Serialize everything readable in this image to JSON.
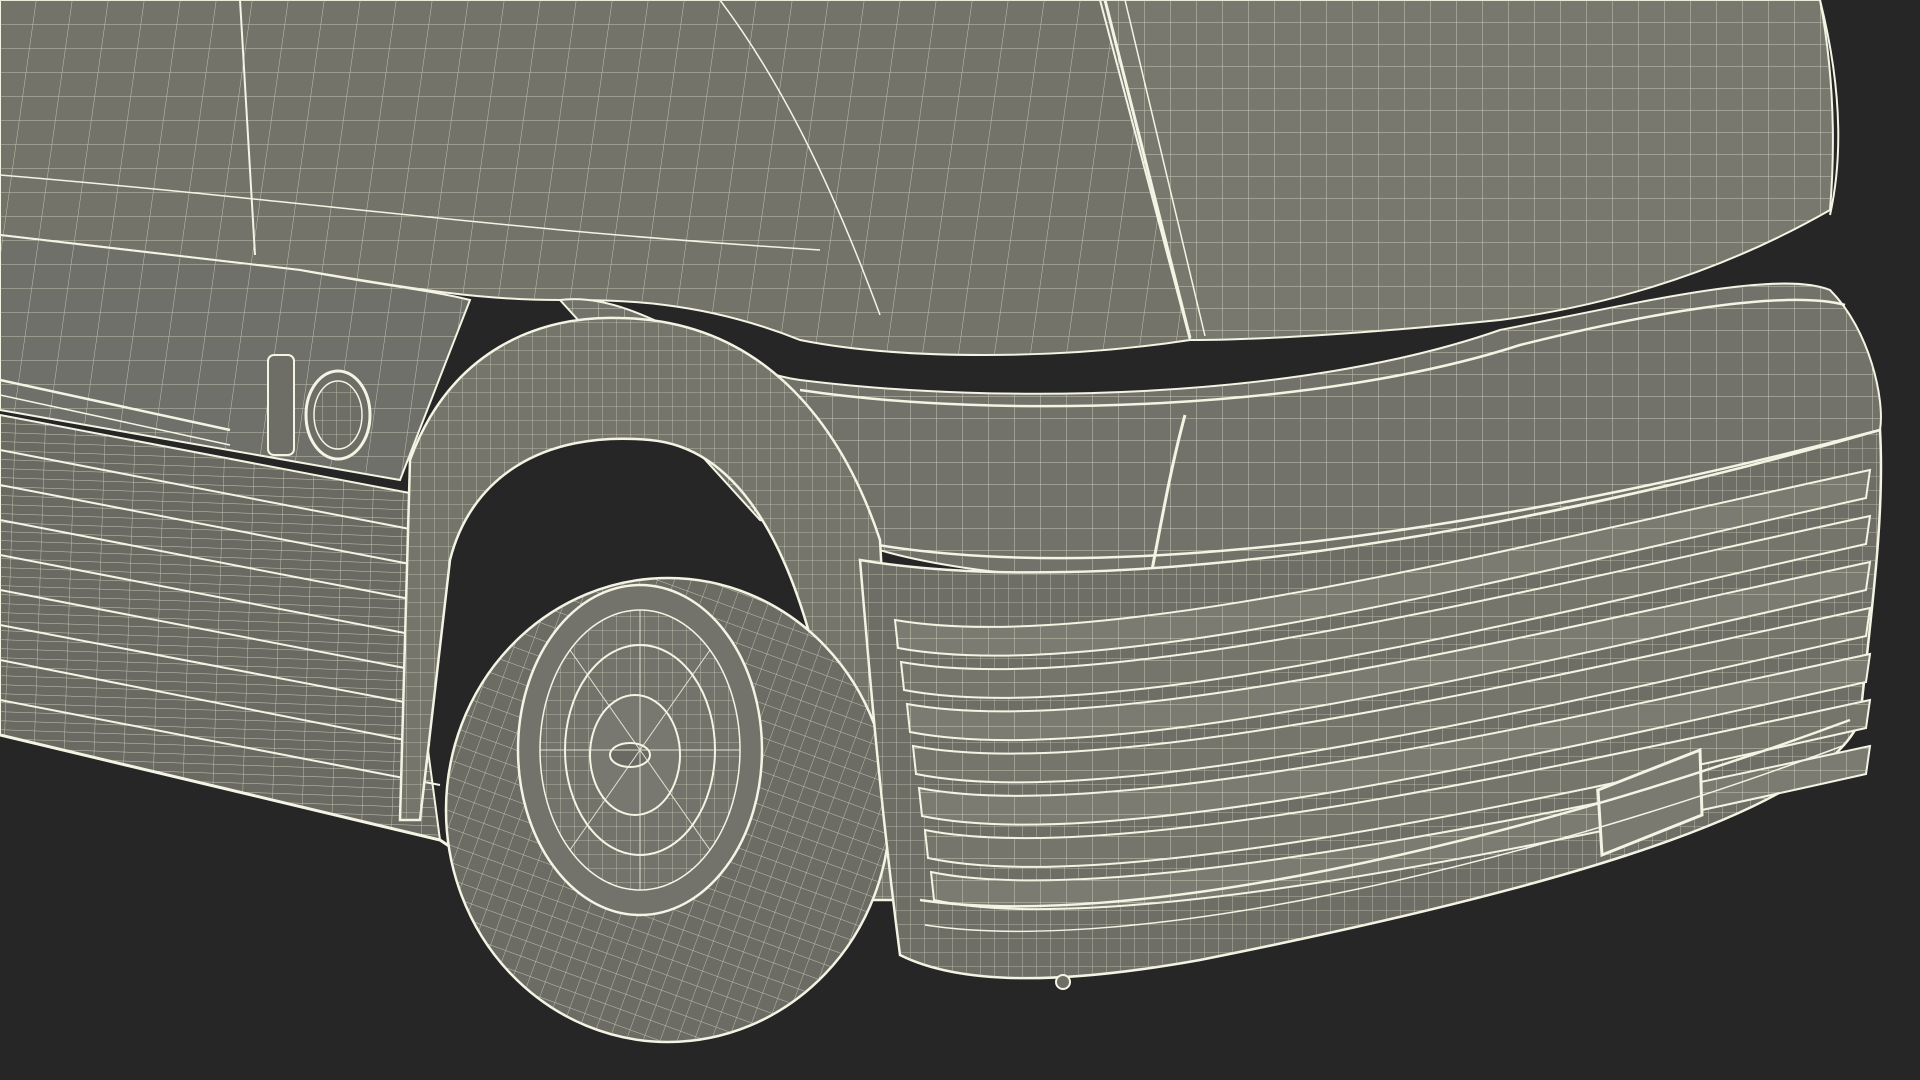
{
  "scene": {
    "subject": "wireframe-truck-front",
    "colors": {
      "background": "#262626",
      "surface": "#75756c",
      "surface_dark": "#65655d",
      "surface_light": "#828278",
      "wire": "#dcdcc8",
      "edge": "#f4f4e4",
      "shadow": "#4a4a44"
    }
  }
}
